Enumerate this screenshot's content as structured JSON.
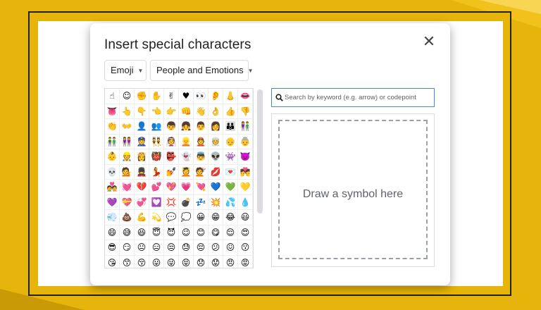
{
  "dialog": {
    "title": "Insert special characters",
    "close_icon": "close-icon"
  },
  "category_dropdown": {
    "value": "Emoji"
  },
  "subcategory_dropdown": {
    "value": "People and Emotions"
  },
  "search": {
    "placeholder": "Search by keyword (e.g. arrow) or codepoint"
  },
  "draw_area": {
    "label": "Draw a symbol here"
  },
  "emoji_grid": [
    "☝",
    "☺",
    "✊",
    "✋",
    "✌",
    "♥",
    "👀",
    "👂",
    "👃",
    "👄",
    "👅",
    "👆",
    "👇",
    "👈",
    "👉",
    "👊",
    "👋",
    "👌",
    "👍",
    "👎",
    "👏",
    "👐",
    "👤",
    "👥",
    "👦",
    "👧",
    "👨",
    "👩",
    "👪",
    "👫",
    "👬",
    "👭",
    "👮",
    "👯",
    "👰",
    "👱",
    "👲",
    "👳",
    "👴",
    "👵",
    "👶",
    "👷",
    "👸",
    "👹",
    "👺",
    "👻",
    "👼",
    "👽",
    "👾",
    "👿",
    "💀",
    "💁",
    "💂",
    "💃",
    "💅",
    "💆",
    "💇",
    "💋",
    "💌",
    "💏",
    "💑",
    "💓",
    "💔",
    "💕",
    "💖",
    "💗",
    "💘",
    "💙",
    "💚",
    "💛",
    "💜",
    "💝",
    "💞",
    "💟",
    "💢",
    "💣",
    "💤",
    "💥",
    "💦",
    "💧",
    "💨",
    "💩",
    "💪",
    "💫",
    "💬",
    "💭",
    "😀",
    "😁",
    "😂",
    "😃",
    "😄",
    "😅",
    "😆",
    "😇",
    "😈",
    "😉",
    "😊",
    "😋",
    "😌",
    "😍",
    "😎",
    "😏",
    "😐",
    "😑",
    "😒",
    "😓",
    "😔",
    "😕",
    "😖",
    "😗",
    "😘",
    "😙",
    "😚",
    "😛",
    "😜",
    "😝",
    "😞",
    "😟",
    "😠",
    "😡"
  ],
  "colors": {
    "background": "#e6b40a",
    "accent": "#4285f4"
  }
}
